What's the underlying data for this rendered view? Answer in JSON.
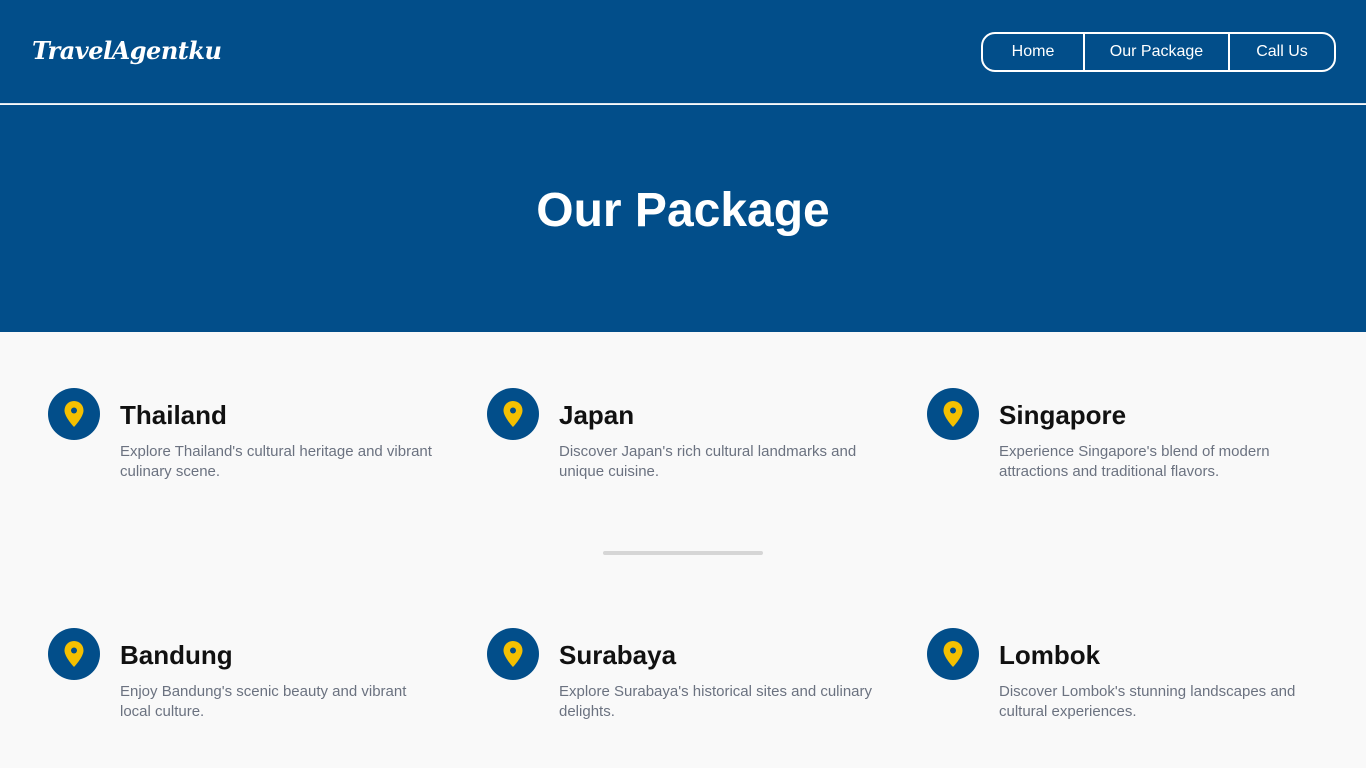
{
  "brand": "TravelAgentku",
  "nav": {
    "home": "Home",
    "package": "Our Package",
    "call": "Call Us"
  },
  "hero": {
    "title": "Our Package"
  },
  "colors": {
    "primary": "#024e8a",
    "pin": "#f5c000",
    "background": "#f9f9f9"
  },
  "packages": [
    {
      "icon": "map-pin-icon",
      "title": "Thailand",
      "desc": "Explore Thailand's cultural heritage and vibrant culinary scene."
    },
    {
      "icon": "map-pin-icon",
      "title": "Japan",
      "desc": "Discover Japan's rich cultural landmarks and unique cuisine."
    },
    {
      "icon": "map-pin-icon",
      "title": "Singapore",
      "desc": "Experience Singapore's blend of modern attractions and traditional flavors."
    },
    {
      "icon": "map-pin-icon",
      "title": "Bandung",
      "desc": "Enjoy Bandung's scenic beauty and vibrant local culture."
    },
    {
      "icon": "map-pin-icon",
      "title": "Surabaya",
      "desc": "Explore Surabaya's historical sites and culinary delights."
    },
    {
      "icon": "map-pin-icon",
      "title": "Lombok",
      "desc": "Discover Lombok's stunning landscapes and cultural experiences."
    }
  ]
}
